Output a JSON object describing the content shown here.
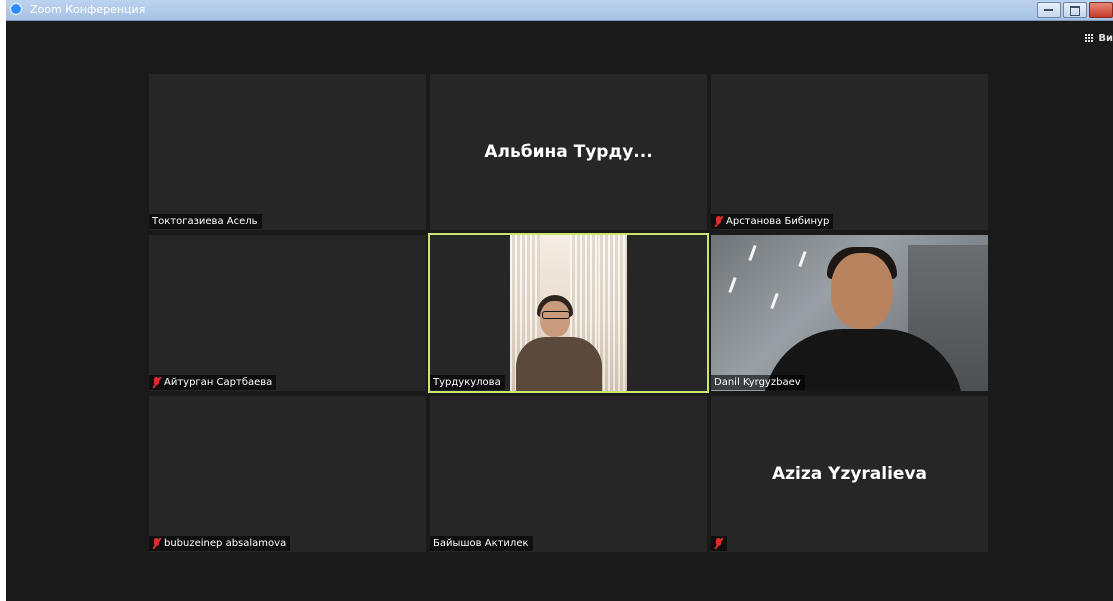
{
  "window": {
    "title": "Zoom Конференция"
  },
  "toolbar": {
    "view_label": "Ви"
  },
  "participants": [
    {
      "name": "Токтогазиева Асель",
      "muted": false,
      "display": "label"
    },
    {
      "name": "Альбина Турду...",
      "muted": false,
      "display": "big-name"
    },
    {
      "name": "Арстанова Бибинур",
      "muted": true,
      "display": "label"
    },
    {
      "name": "Айтурган Сартбаева",
      "muted": true,
      "display": "label"
    },
    {
      "name": "Турдукулова",
      "muted": false,
      "display": "video",
      "active_speaker": true
    },
    {
      "name": "Danil Kyrgyzbaev",
      "muted": false,
      "display": "video"
    },
    {
      "name": "bubuzeinep absalamova",
      "muted": true,
      "display": "label"
    },
    {
      "name": "Байышов Актилек",
      "muted": false,
      "display": "label"
    },
    {
      "name": "Aziza Yzyralieva",
      "muted": true,
      "display": "big-name"
    }
  ],
  "colors": {
    "background": "#1a1a1a",
    "tile": "#262626",
    "active_speaker_border": "#c9e66a",
    "muted_icon": "#e02b2b"
  }
}
